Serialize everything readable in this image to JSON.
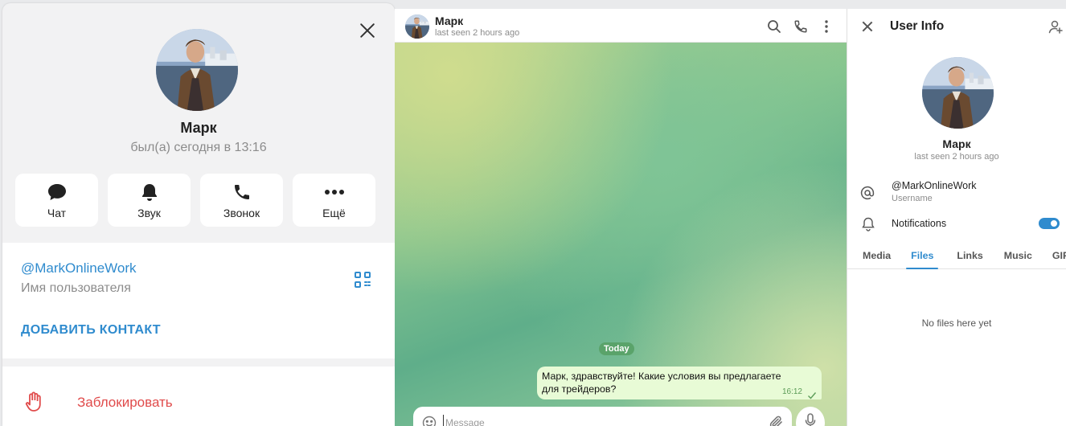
{
  "profile_modal": {
    "name": "Марк",
    "status": "был(а) сегодня в 13:16",
    "actions": [
      {
        "label": "Чат",
        "icon": "chat-bubble-icon"
      },
      {
        "label": "Звук",
        "icon": "bell-icon"
      },
      {
        "label": "Звонок",
        "icon": "phone-icon"
      },
      {
        "label": "Ещё",
        "icon": "more-dots-icon"
      }
    ],
    "username": "@MarkOnlineWork",
    "username_caption": "Имя пользователя",
    "add_contact": "ДОБАВИТЬ КОНТАКТ",
    "block": "Заблокировать"
  },
  "chat": {
    "name": "Марк",
    "status": "last seen 2 hours ago",
    "date_badge": "Today",
    "messages": [
      {
        "text": "Марк, здравствуйте! Какие условия вы предлагаете для трейдеров?",
        "time": "16:12",
        "read": true
      }
    ],
    "composer_placeholder": "Message"
  },
  "user_info": {
    "title": "User Info",
    "name": "Марк",
    "status": "last seen 2 hours ago",
    "username": "@MarkOnlineWork",
    "username_caption": "Username",
    "notifications_label": "Notifications",
    "notifications_on": true,
    "tabs": [
      "Media",
      "Files",
      "Links",
      "Music",
      "GIF"
    ],
    "active_tab": "Files",
    "empty_text": "No files here yet"
  },
  "colors": {
    "accent": "#2f8bce",
    "danger": "#e04b4b",
    "bubble": "#e8fbd6",
    "date_badge": "#5aa36a"
  }
}
